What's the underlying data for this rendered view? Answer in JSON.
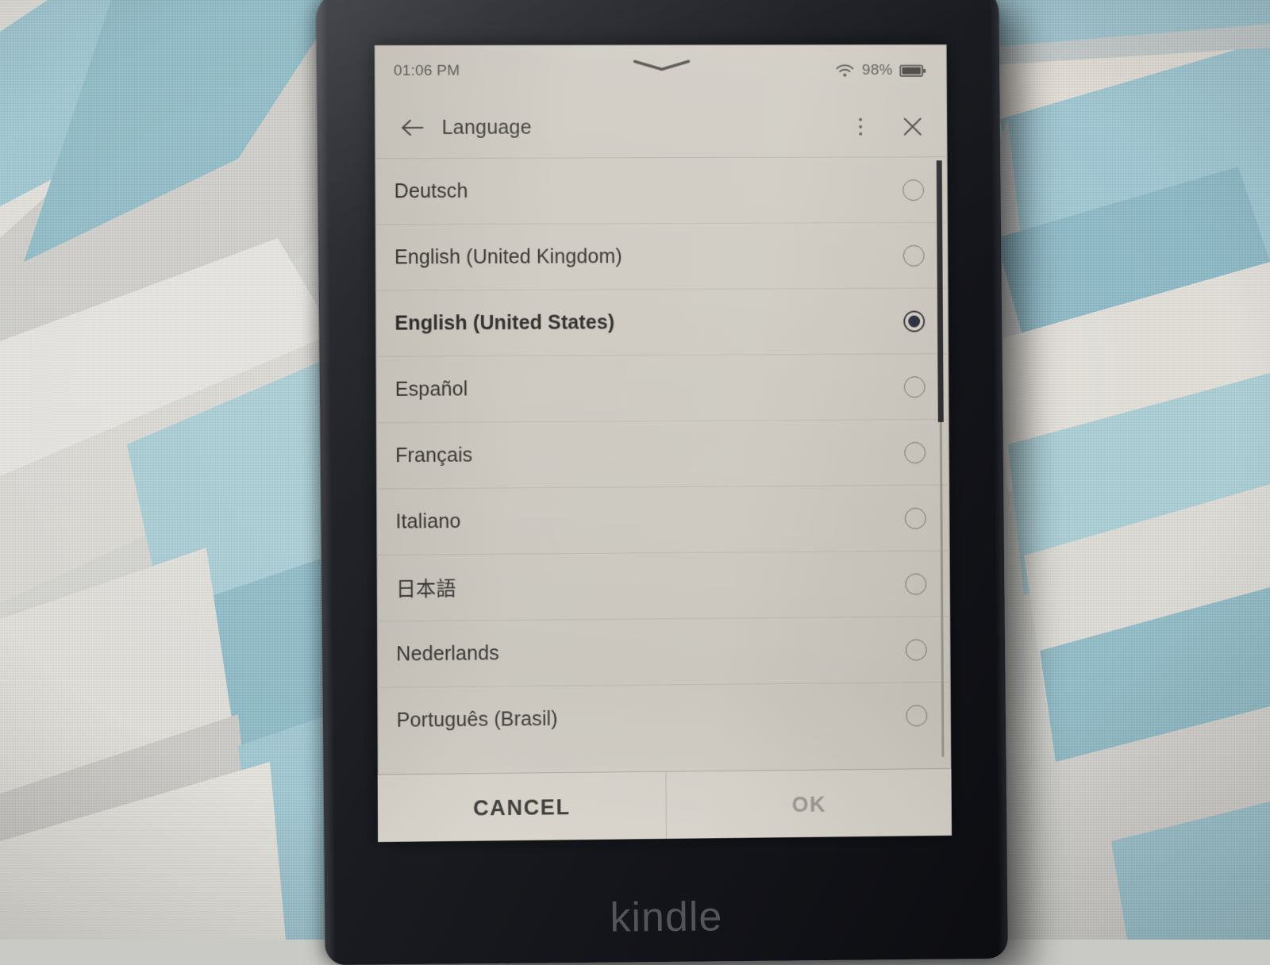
{
  "scene": {
    "device_brand": "kindle",
    "surface_colors": {
      "teal": "#8fb9c4",
      "teal_dark": "#7dadbb",
      "off_white": "#e2e0dc",
      "gray": "#c3c3c0",
      "light_gray": "#d8d7d3"
    },
    "bezel_color": "#16181d"
  },
  "status_bar": {
    "clock": "01:06 PM",
    "wifi_icon": "wifi-icon",
    "battery_percent": "98%",
    "battery_icon": "battery-full-icon",
    "pulldown_icon": "chevron-down-icon"
  },
  "header": {
    "back_icon": "arrow-left-icon",
    "title": "Language",
    "menu_icon": "overflow-menu-icon",
    "close_icon": "close-icon"
  },
  "language_list": {
    "selected_value": "English (United States)",
    "items": [
      {
        "label": "Deutsch",
        "selected": false
      },
      {
        "label": "English (United Kingdom)",
        "selected": false
      },
      {
        "label": "English (United States)",
        "selected": true
      },
      {
        "label": "Español",
        "selected": false
      },
      {
        "label": "Français",
        "selected": false
      },
      {
        "label": "Italiano",
        "selected": false
      },
      {
        "label": "日本語",
        "selected": false
      },
      {
        "label": "Nederlands",
        "selected": false
      },
      {
        "label": "Português (Brasil)",
        "selected": false
      }
    ]
  },
  "scrollbar": {
    "thumb_position_percent": 0,
    "thumb_size_percent": 44
  },
  "footer": {
    "cancel_label": "CANCEL",
    "ok_label": "OK",
    "ok_enabled": false
  }
}
